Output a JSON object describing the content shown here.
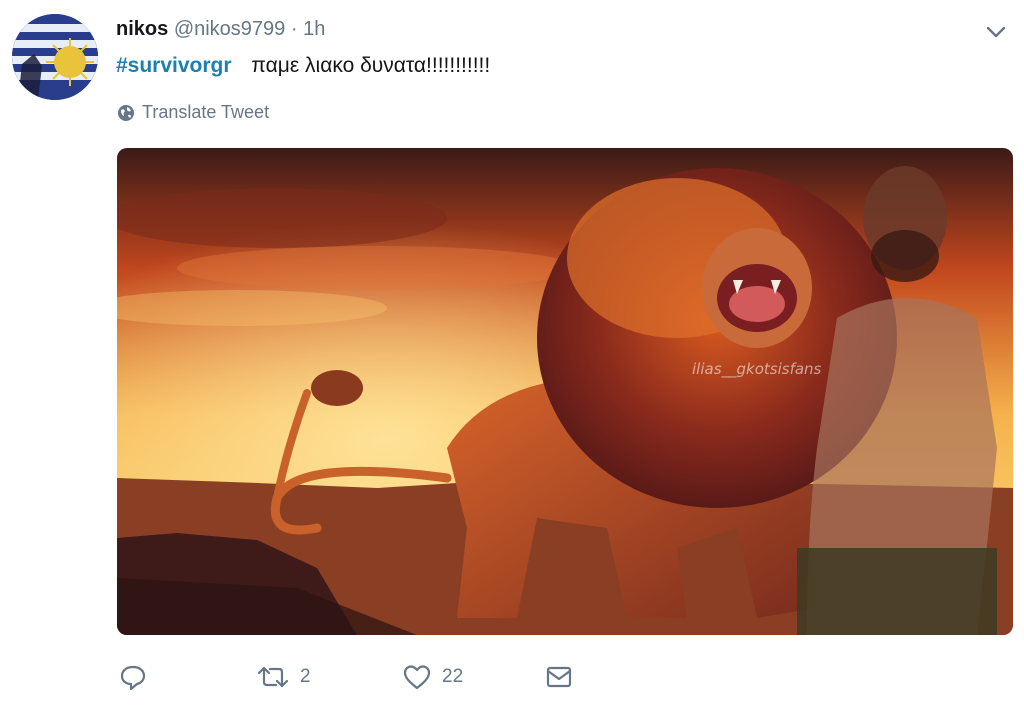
{
  "tweet": {
    "display_name": "nikos",
    "handle": "@nikos9799",
    "separator": "·",
    "time": "1h",
    "hashtag": "#survivorgr",
    "body": "παμε λιακο δυνατα!!!!!!!!!!!",
    "translate_label": "Translate Tweet",
    "media": {
      "watermark": "ilias__gkotsisfans"
    }
  },
  "actions": {
    "reply_count": "",
    "retweet_count": "2",
    "like_count": "22"
  },
  "icons": {
    "more": "chevron-down-icon",
    "translate": "globe-icon",
    "reply": "reply-icon",
    "retweet": "retweet-icon",
    "like": "heart-icon",
    "dm": "envelope-icon"
  },
  "colors": {
    "link": "#1b7fb0",
    "muted": "#657786",
    "text": "#14171a"
  }
}
